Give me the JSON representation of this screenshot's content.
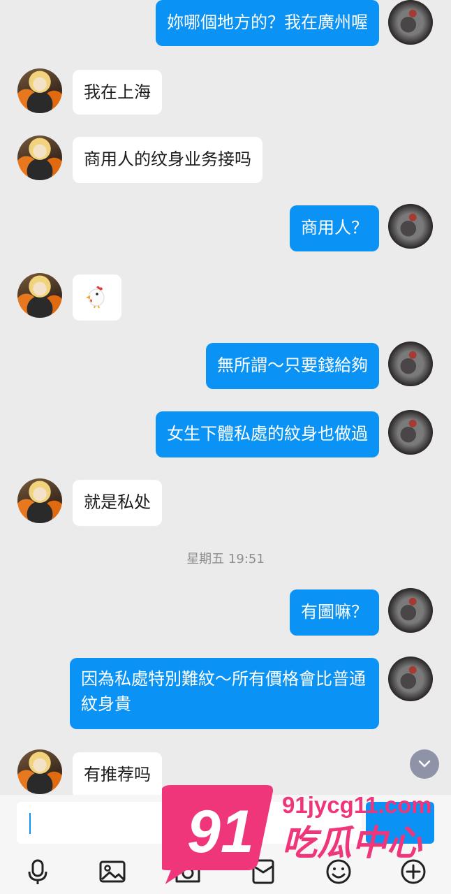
{
  "messages": [
    {
      "side": "out",
      "text": "妳哪個地方的？我在廣州喔"
    },
    {
      "side": "in",
      "text": "我在上海"
    },
    {
      "side": "in",
      "text": "商用人的纹身业务接吗"
    },
    {
      "side": "out",
      "text": "商用人？"
    },
    {
      "side": "in",
      "emoji": "chicken"
    },
    {
      "side": "out",
      "text": "無所謂～只要錢給夠"
    },
    {
      "side": "out",
      "text": "女生下體私處的紋身也做過"
    },
    {
      "side": "in",
      "text": "就是私处"
    },
    {
      "timestamp": "星期五 19:51"
    },
    {
      "side": "out",
      "text": "有圖嘛？"
    },
    {
      "side": "out",
      "text": "因為私處特別難紋～所有價格會比普通紋身貴"
    },
    {
      "side": "in",
      "text": "有推荐吗"
    }
  ],
  "input": {
    "value": "",
    "send_label": ""
  },
  "toolbar": [
    "microphone-icon",
    "image-icon",
    "camera-icon",
    "red-packet-icon",
    "emoji-icon",
    "plus-icon"
  ],
  "watermark": {
    "number": "91",
    "domain": "91jycg11.com",
    "name": "吃瓜中心"
  },
  "colors": {
    "outgoing_bubble": "#0a93f5",
    "incoming_bubble": "#ffffff",
    "background": "#ebebeb",
    "watermark_pink": "#f0367a"
  }
}
